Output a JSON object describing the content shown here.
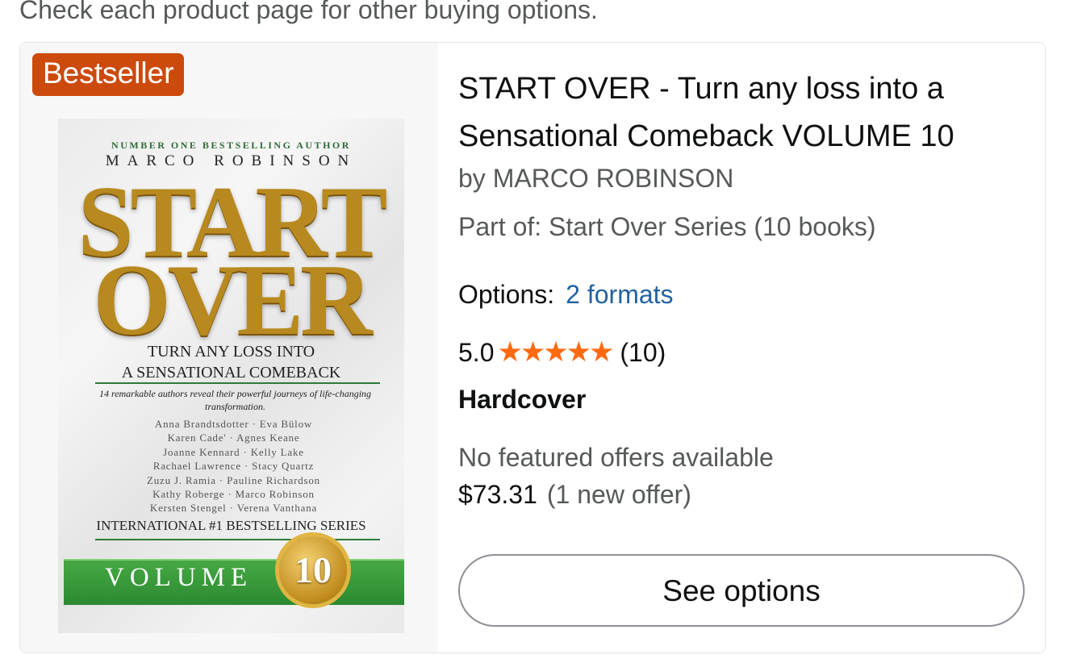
{
  "notice": "Check each product page for other buying options.",
  "product": {
    "badge": "Bestseller",
    "title": "START OVER - Turn any loss into a Sensational Comeback VOLUME 10",
    "byline": "by MARCO ROBINSON",
    "series": "Part of: Start Over Series (10 books)",
    "options_label": "Options:",
    "options_link": "2 formats",
    "rating": "5.0",
    "stars": "★★★★★",
    "rating_value": 5,
    "rating_count": "(10)",
    "format": "Hardcover",
    "no_offers": "No featured offers available",
    "price": "$73.31",
    "offer_count": "(1 new offer)",
    "button_label": "See options",
    "colors": {
      "badge": "#cc4a0c",
      "star": "#ff6a10",
      "link": "#2162a1"
    }
  },
  "cover": {
    "top_line": "Number One Bestselling Author",
    "author": "MARCO ROBINSON",
    "title_line1": "START",
    "title_line2": "OVER",
    "subtitle_line1": "TURN ANY LOSS INTO",
    "subtitle_line2": "A SENSATIONAL COMEBACK",
    "description": "14 remarkable authors reveal their powerful journeys of life-changing transformation.",
    "authors": [
      "Anna Brandtsdotter · Eva Bülow",
      "Karen Cade' · Agnes Keane",
      "Joanne Kennard · Kelly Lake",
      "Rachael Lawrence · Stacy Quartz",
      "Zuzu J. Ramia · Pauline Richardson",
      "Kathy Roberge · Marco Robinson",
      "Kersten Stengel · Verena Vanthana"
    ],
    "series_text": "INTERNATIONAL #1 BESTSELLING SERIES",
    "volume_label": "VOLUME",
    "volume_number": "10"
  }
}
